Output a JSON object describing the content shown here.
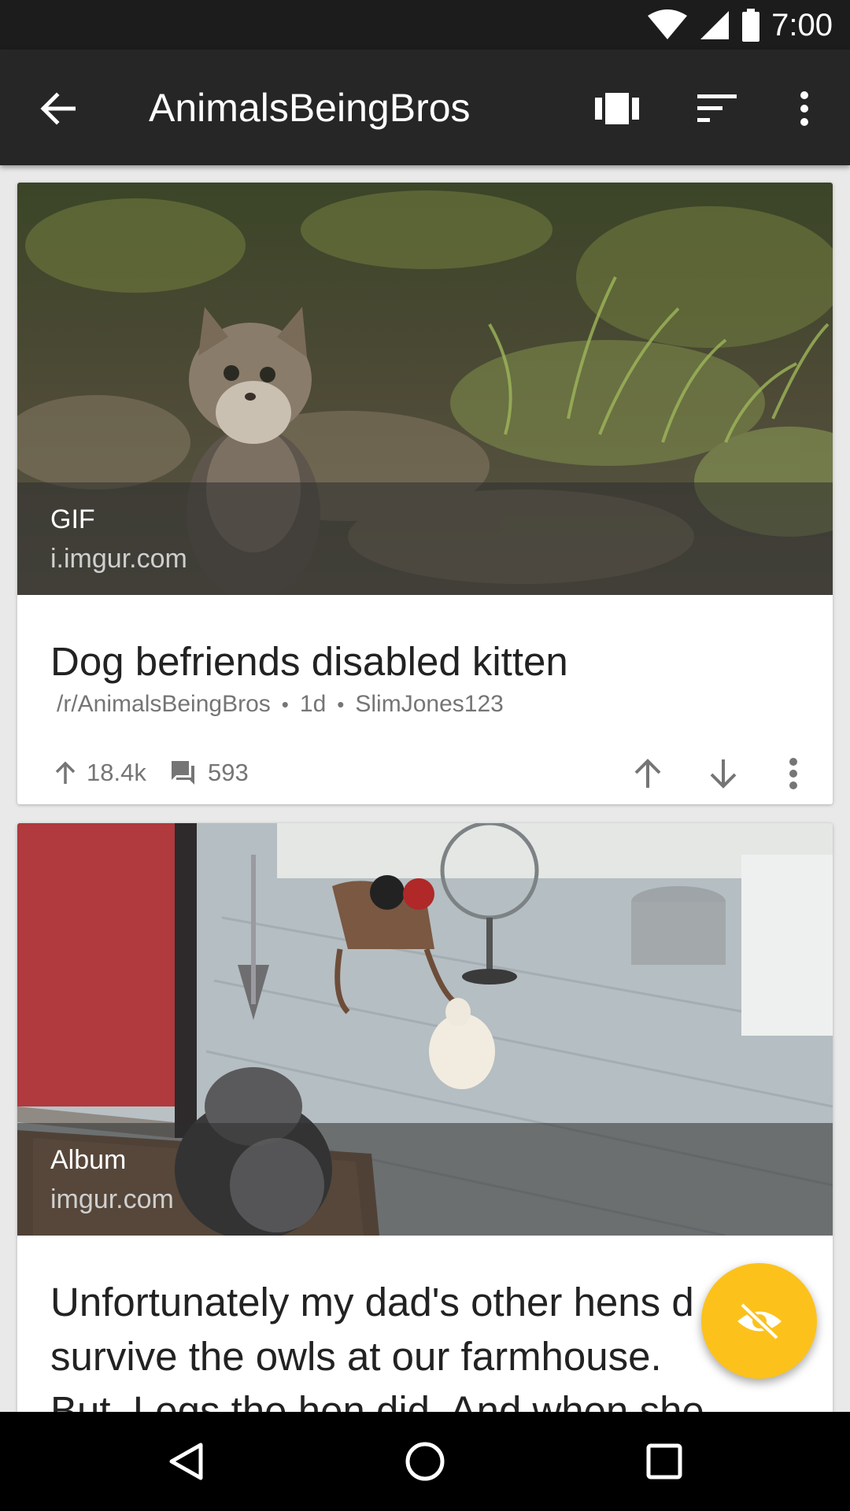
{
  "status_bar": {
    "time": "7:00"
  },
  "toolbar": {
    "title": "AnimalsBeingBros",
    "icons": [
      "back-arrow-icon",
      "card-view-icon",
      "sort-icon",
      "overflow-menu-icon"
    ]
  },
  "posts": [
    {
      "media_type": "GIF",
      "domain": "i.imgur.com",
      "title": "Dog befriends disabled kitten",
      "subreddit": "/r/AnimalsBeingBros",
      "age": "1d",
      "author": "SlimJones123",
      "score": "18.4k",
      "comments": "593"
    },
    {
      "media_type": "Album",
      "domain": "imgur.com",
      "title_lines": [
        "Unfortunately my dad's other hens d",
        "survive the owls at our farmhouse.",
        "But, Legs the hen did. And when she"
      ]
    }
  ],
  "fab": {
    "icon": "hide-read-icon"
  },
  "navbar": {
    "icons": [
      "nav-back-icon",
      "nav-home-icon",
      "nav-recents-icon"
    ]
  },
  "colors": {
    "toolbar": "#262626",
    "status_bar": "#1c1c1c",
    "fab": "#fcc21b",
    "card": "#ffffff",
    "background": "#e9e9e9"
  }
}
